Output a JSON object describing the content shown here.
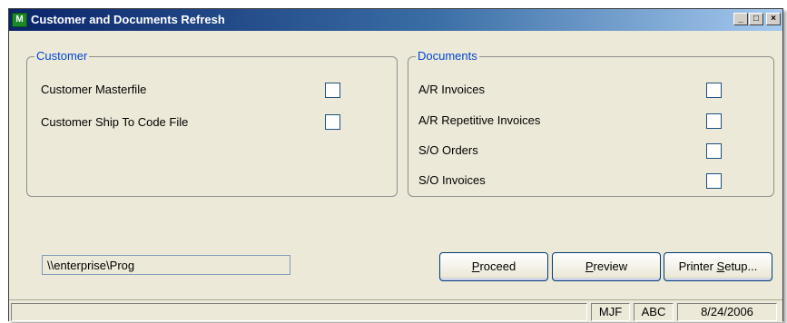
{
  "window": {
    "title": "Customer and Documents Refresh",
    "icon_text": "M",
    "minimize_glyph": "_",
    "maximize_glyph": "□",
    "close_glyph": "×"
  },
  "customer_group": {
    "title": "Customer",
    "items": [
      {
        "label": "Customer Masterfile",
        "checked": false
      },
      {
        "label": "Customer Ship To Code File",
        "checked": false
      }
    ]
  },
  "documents_group": {
    "title": "Documents",
    "items": [
      {
        "label": "A/R Invoices",
        "checked": false
      },
      {
        "label": "A/R Repetitive Invoices",
        "checked": false
      },
      {
        "label": "S/O Orders",
        "checked": false
      },
      {
        "label": "S/O Invoices",
        "checked": false
      }
    ]
  },
  "path_field": {
    "value": "\\\\enterprise\\Prog"
  },
  "buttons": {
    "proceed": {
      "first": "P",
      "rest": "roceed"
    },
    "preview": {
      "first": "P",
      "rest": "review"
    },
    "printer_setup": {
      "before": "Printer ",
      "underlined": "S",
      "after": "etup..."
    }
  },
  "statusbar": {
    "user": "MJF",
    "company": "ABC",
    "date": "8/24/2006"
  },
  "colors": {
    "title_gradient_start": "#0a246a",
    "title_gradient_end": "#a6caf0",
    "group_title": "#0046d5",
    "window_bg": "#ece9d8"
  }
}
